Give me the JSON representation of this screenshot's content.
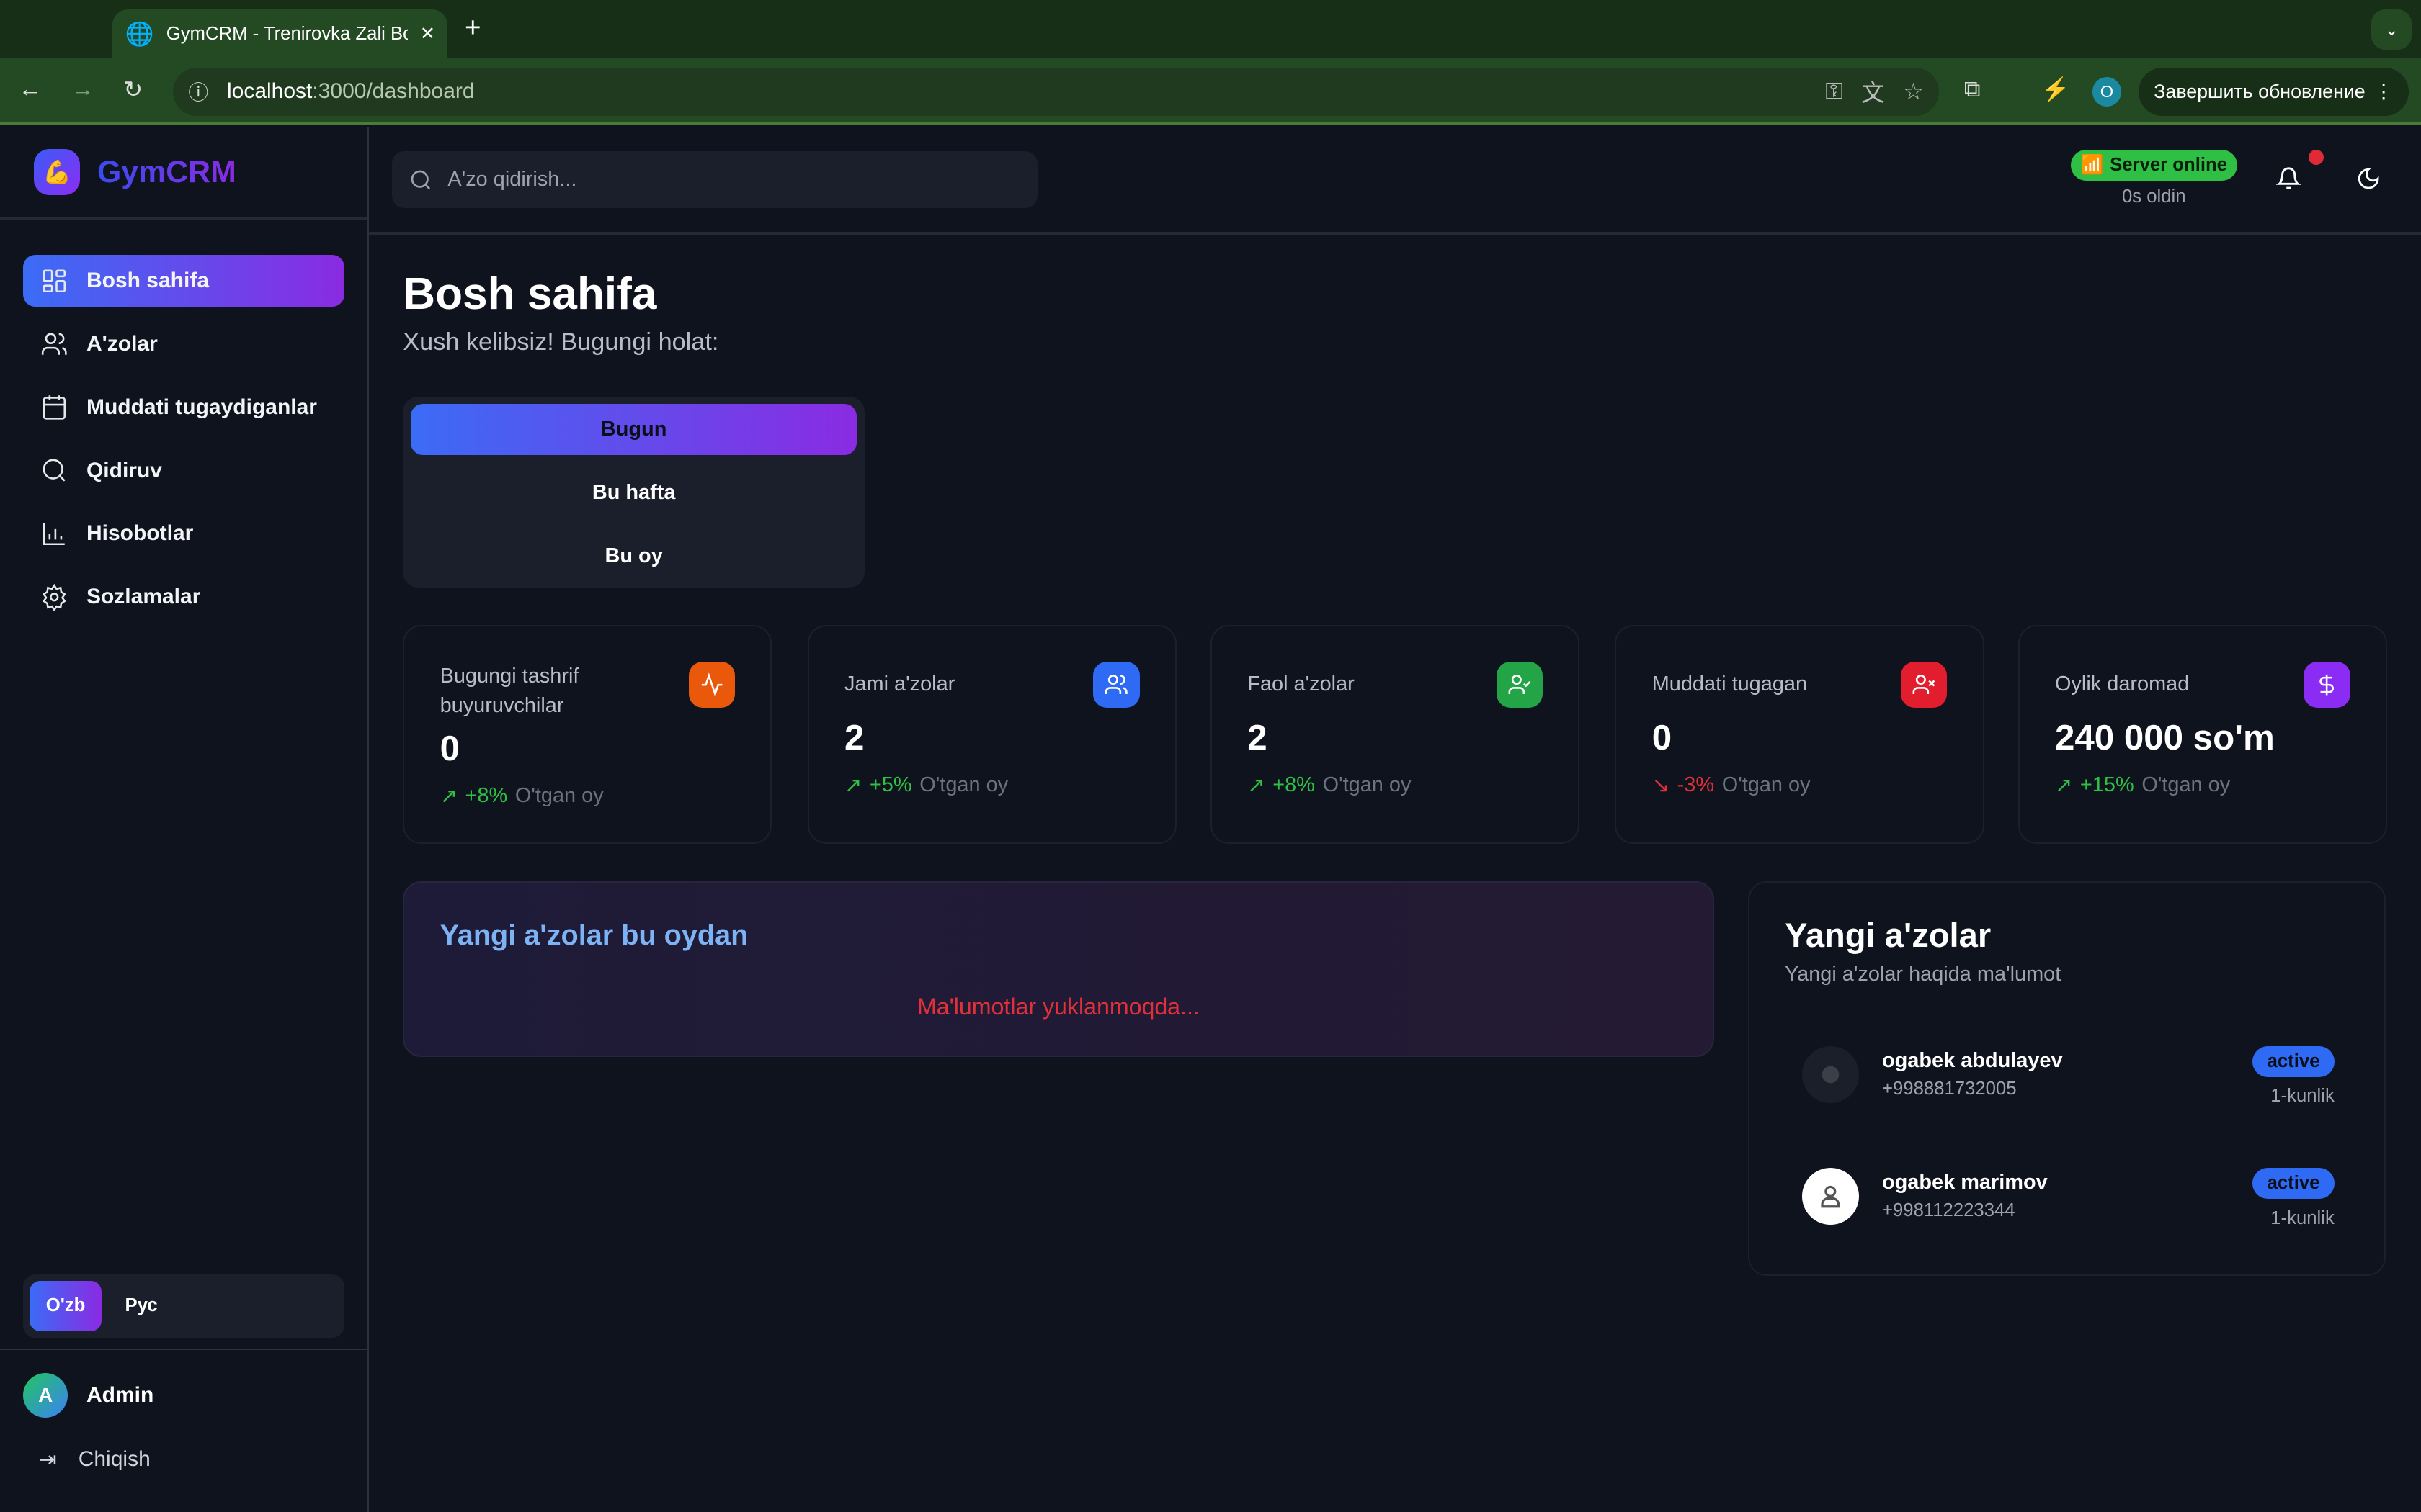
{
  "browser": {
    "tab_title": "GymCRM - Trenirovka Zali Bo",
    "url_host": "localhost",
    "url_path": ":3000/dashboard",
    "profile_initial": "O",
    "update_button": "Завершить обновление"
  },
  "sidebar": {
    "brand": "GymCRM",
    "items": [
      {
        "label": "Bosh sahifa",
        "icon": "dashboard-grid-icon",
        "active": true
      },
      {
        "label": "A'zolar",
        "icon": "users-icon"
      },
      {
        "label": "Muddati tugaydiganlar",
        "icon": "calendar-icon"
      },
      {
        "label": "Qidiruv",
        "icon": "search-icon"
      },
      {
        "label": "Hisobotlar",
        "icon": "bar-chart-icon"
      },
      {
        "label": "Sozlamalar",
        "icon": "gear-icon"
      }
    ],
    "languages": [
      {
        "label": "O'zb",
        "active": true
      },
      {
        "label": "Рус"
      }
    ],
    "user": {
      "initial": "A",
      "name": "Admin"
    },
    "logout": "Chiqish"
  },
  "header": {
    "search_placeholder": "A'zo qidirish...",
    "server_status": "Server online",
    "server_ago": "0s oldin",
    "status_color": "#2fbf45"
  },
  "page": {
    "title": "Bosh sahifa",
    "subtitle": "Xush kelibsiz! Bugungi holat:",
    "periods": [
      {
        "label": "Bugun",
        "active": true
      },
      {
        "label": "Bu hafta"
      },
      {
        "label": "Bu oy"
      }
    ]
  },
  "stats": [
    {
      "label": "Bugungi tashrif buyuruvchilar",
      "value": "0",
      "change": "+8%",
      "period": "O'tgan oy",
      "trend": "up",
      "color": "#ea580c",
      "icon": "activity-icon"
    },
    {
      "label": "Jami a'zolar",
      "value": "2",
      "change": "+5%",
      "period": "O'tgan oy",
      "trend": "up",
      "color": "#2f6af5",
      "icon": "users-icon"
    },
    {
      "label": "Faol a'zolar",
      "value": "2",
      "change": "+8%",
      "period": "O'tgan oy",
      "trend": "up",
      "color": "#22a447",
      "icon": "user-check-icon"
    },
    {
      "label": "Muddati tugagan",
      "value": "0",
      "change": "-3%",
      "period": "O'tgan oy",
      "trend": "down",
      "color": "#e11d2e",
      "icon": "user-x-icon"
    },
    {
      "label": "Oylik daromad",
      "value": "240 000 so'm",
      "change": "+15%",
      "period": "O'tgan oy",
      "trend": "up",
      "color": "#8b2cf5",
      "icon": "dollar-icon"
    }
  ],
  "new_members_chart": {
    "title": "Yangi a'zolar bu oydan",
    "loading": "Ma'lumotlar yuklanmoqda..."
  },
  "new_members": {
    "title": "Yangi a'zolar",
    "subtitle": "Yangi a'zolar haqida ma'lumot",
    "items": [
      {
        "name": "ogabek abdulayev",
        "phone": "+998881732005",
        "status": "active",
        "plan": "1-kunlik",
        "avatar": "photo"
      },
      {
        "name": "ogabek marimov",
        "phone": "+998112223344",
        "status": "active",
        "plan": "1-kunlik",
        "avatar": "default-user"
      }
    ]
  }
}
